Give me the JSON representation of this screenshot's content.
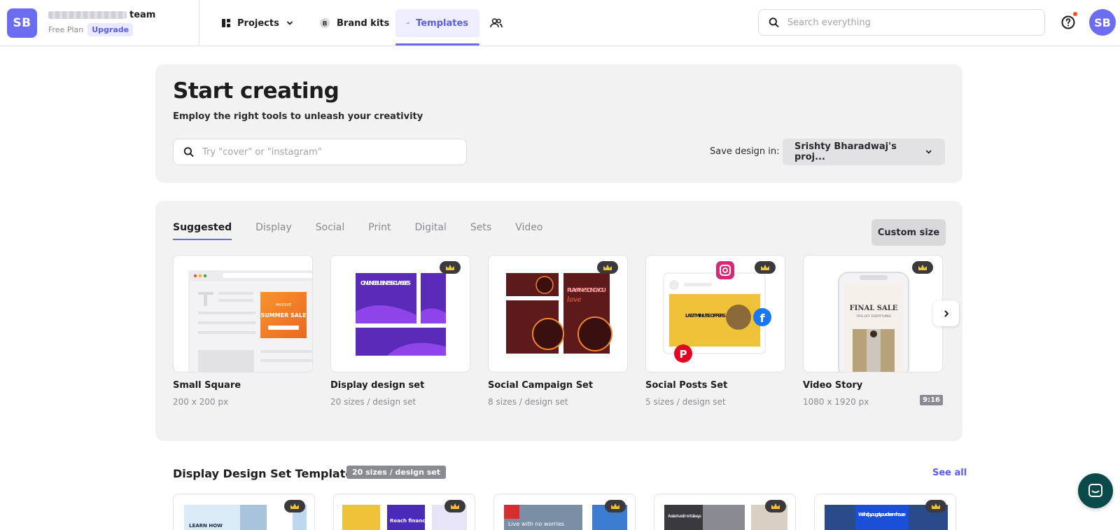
{
  "topbar": {
    "team_initials": "SB",
    "team_suffix": "team",
    "plan": "Free Plan",
    "upgrade": "Upgrade",
    "nav": {
      "projects": "Projects",
      "brand_kits": "Brand kits",
      "templates": "Templates"
    },
    "search_placeholder": "Search everything",
    "user_initials": "SB"
  },
  "start": {
    "title": "Start creating",
    "subtitle": "Employ the right tools to unleash your creativity",
    "search_placeholder": "Try \"cover\" or \"instagram\"",
    "save_label": "Save design in:",
    "save_value": "Srishty Bharadwaj's proj..."
  },
  "templates": {
    "tabs": [
      "Suggested",
      "Display",
      "Social",
      "Print",
      "Digital",
      "Sets",
      "Video"
    ],
    "custom_size": "Custom size",
    "items": [
      {
        "name": "Small Square",
        "size": "200 x 200 px",
        "premium": false
      },
      {
        "name": "Display design set",
        "size": "20 sizes / design set",
        "premium": true
      },
      {
        "name": "Social Campaign Set",
        "size": "8 sizes / design set",
        "premium": true
      },
      {
        "name": "Social Posts Set",
        "size": "5 sizes / design set",
        "premium": true
      },
      {
        "name": "Video Story",
        "size": "1080 x 1920 px",
        "premium": true,
        "ratio": "9:16"
      }
    ],
    "thumb_text": {
      "summer_top": "MASSIVE",
      "summer_main": "SUMMER SALE",
      "online": "ONLINE BUSINESS CLASSES",
      "play": "PLAY ANY SONG YOU",
      "love": "love",
      "last": "LAST MINUTE OFFERS",
      "final": "FINAL SALE",
      "final_sub": "70% OFF EVERYTHING"
    }
  },
  "display_section": {
    "title": "Display Design Set Templates",
    "badge": "20 sizes / design set",
    "see_all": "See all",
    "thumb_text": [
      "LEARN HOW",
      "Reach financial",
      "Live with no worries",
      "A wise investment always",
      "We help you get your dream house"
    ]
  },
  "colors": {
    "accent": "#6b6cf0",
    "purple": "#5a2bb8",
    "dark_red": "#5e1a1a",
    "yellow": "#f0c23a"
  }
}
